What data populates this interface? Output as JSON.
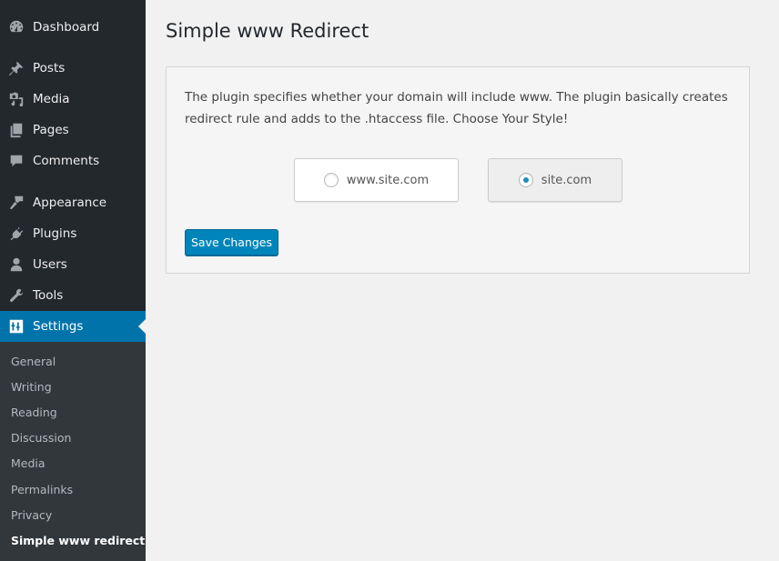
{
  "sidebar": {
    "items": [
      {
        "label": "Dashboard",
        "icon": "dashboard-icon"
      },
      {
        "label": "Posts",
        "icon": "pin-icon"
      },
      {
        "label": "Media",
        "icon": "media-icon"
      },
      {
        "label": "Pages",
        "icon": "pages-icon"
      },
      {
        "label": "Comments",
        "icon": "comment-icon"
      },
      {
        "label": "Appearance",
        "icon": "paintbrush-icon"
      },
      {
        "label": "Plugins",
        "icon": "plug-icon"
      },
      {
        "label": "Users",
        "icon": "user-icon"
      },
      {
        "label": "Tools",
        "icon": "wrench-icon"
      },
      {
        "label": "Settings",
        "icon": "settings-sliders-icon",
        "active": true
      }
    ],
    "submenu": [
      {
        "label": "General"
      },
      {
        "label": "Writing"
      },
      {
        "label": "Reading"
      },
      {
        "label": "Discussion"
      },
      {
        "label": "Media"
      },
      {
        "label": "Permalinks"
      },
      {
        "label": "Privacy"
      },
      {
        "label": "Simple www redirect",
        "current": true
      }
    ]
  },
  "main": {
    "title": "Simple www Redirect",
    "description": "The plugin specifies whether your domain will include www. The plugin basically creates redirect rule and adds to the .htaccess file. Choose Your Style!",
    "options": [
      {
        "label": "www.site.com",
        "selected": false
      },
      {
        "label": "site.com",
        "selected": true
      }
    ],
    "save_label": "Save Changes"
  },
  "colors": {
    "sidebar_bg": "#23282d",
    "submenu_bg": "#32373c",
    "accent": "#0073aa",
    "button": "#0085ba"
  }
}
